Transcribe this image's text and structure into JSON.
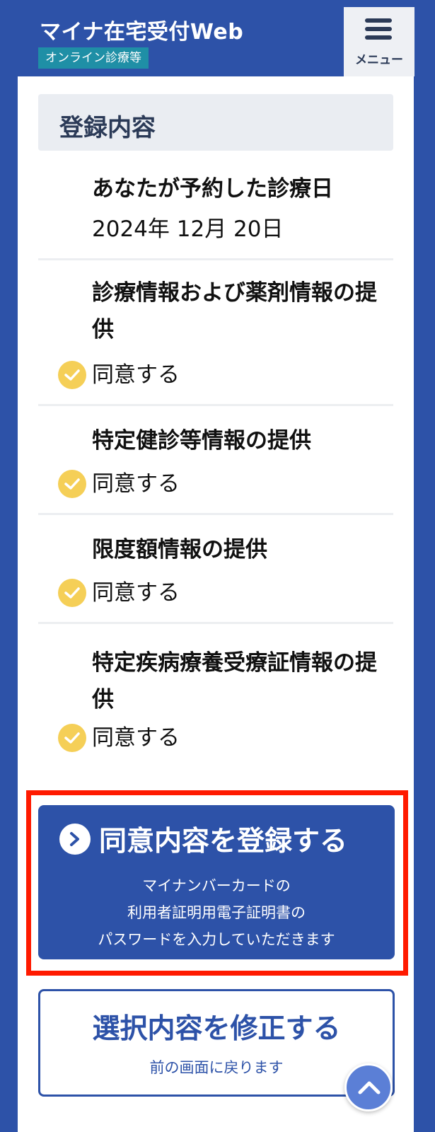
{
  "header": {
    "app_title": "マイナ在宅受付Web",
    "app_subtitle": "オンライン診療等",
    "menu_label": "メニュー"
  },
  "section": {
    "title": "登録内容"
  },
  "items": [
    {
      "title": "あなたが予約した診療日",
      "value": "2024年 12月 20日"
    },
    {
      "title": "診療情報および薬剤情報の提供",
      "value": "同意する"
    },
    {
      "title": "特定健診等情報の提供",
      "value": "同意する"
    },
    {
      "title": "限度額情報の提供",
      "value": "同意する"
    },
    {
      "title": "特定疾病療養受療証情報の提供",
      "value": "同意する"
    }
  ],
  "primary_button": {
    "label": "同意内容を登録する",
    "note_line1": "マイナンバーカードの",
    "note_line2": "利用者証明用電子証明書の",
    "note_line3": "パスワードを入力していただきます"
  },
  "secondary_button": {
    "label": "選択内容を修正する",
    "note": "前の画面に戻ります"
  },
  "icons": {
    "menu": "hamburger-icon",
    "check": "check-circle-icon",
    "arrow": "chevron-right-icon",
    "to_top": "chevron-up-icon"
  },
  "colors": {
    "brand_blue": "#2d52a8",
    "subtitle_teal": "#1f8fa6",
    "check_yellow": "#f5cf57",
    "highlight_red": "#ff1a00"
  }
}
